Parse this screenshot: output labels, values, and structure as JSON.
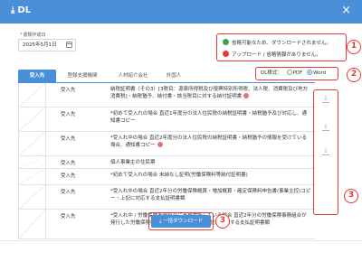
{
  "dialog": {
    "title": "DL",
    "close_glyph": "×"
  },
  "date": {
    "label": "書類作成日",
    "required_mark": "*",
    "value": "2025年5月1日"
  },
  "legend": {
    "items": [
      {
        "color": "#43a047",
        "text": "省略可能なため、ダウンロードされません。"
      },
      {
        "color": "#e53935",
        "text": "アップロード / 省略情報がありません。"
      }
    ]
  },
  "tabs": [
    "受入先",
    "登録支援機関",
    "人材紹介会社",
    "外国人"
  ],
  "format": {
    "label": "DL様式：",
    "options": [
      "PDF",
      "Word"
    ],
    "selected": "Word"
  },
  "rows": [
    {
      "dest": "受入先",
      "doc": "納税証明書（その3）[3税目：源泉所得税及び復興特別所得税、法人税、消費税及び地方消費税]・納税猶予、納付書・該当税目に対する納付証明書",
      "flag": true
    },
    {
      "dest": "受入先",
      "doc": "*初めて受入れの場合 直近1年度分の法人住民税の納税証明書・納税猶予及び対応し、通知書コピー",
      "flag": false
    },
    {
      "dest": "受入先",
      "doc": "*受入れ中の場合 直近2年度分の法人住民税の納税証明書・納税猶予の情報を受けている場合、通知書コピー",
      "flag": true
    },
    {
      "dest": "受入先",
      "doc": "個人事業主の住民票",
      "flag": false
    },
    {
      "dest": "受入先",
      "doc": "*初めて受入れの場合 未納なし証明(労働保険料等納付証明書)",
      "flag": false
    },
    {
      "dest": "受入先",
      "doc": "*受入れ中の場合 直近2年分の労働保険概算・増加概算・確定保険料申告書(事業主控)コピー・上記に対応する支払証明書類",
      "flag": false
    },
    {
      "dest": "受入先",
      "doc": "*受入れ中 / 労働保険事務組合に事務委託している場合 直近2年分の労働保険事務組合が発行した労働保険料等納入通知書コピー・上記に対応する支払証明書類",
      "flag": false
    }
  ],
  "bulk_button": {
    "label": "一括ダウンロード"
  },
  "callouts": {
    "info": "1",
    "format": "2",
    "download": "3",
    "bulk": "3"
  },
  "colors": {
    "accent": "#4a90d9",
    "callout": "#e53935",
    "ok": "#43a047"
  },
  "icons": {
    "download": "download-icon",
    "calendar": "calendar-icon",
    "close": "close-icon"
  }
}
